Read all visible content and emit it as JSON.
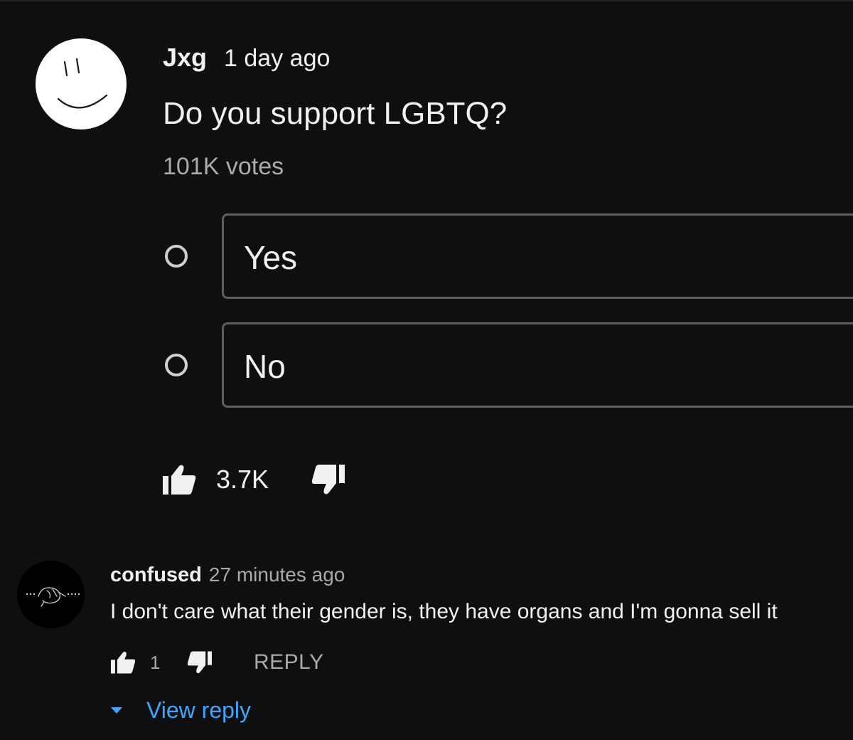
{
  "post": {
    "author": "Jxg",
    "time": "1 day ago",
    "question": "Do you support LGBTQ?",
    "votes": "101K votes",
    "options": [
      {
        "label": "Yes"
      },
      {
        "label": "No"
      }
    ],
    "likes": "3.7K"
  },
  "reply_comment": {
    "author": "confused",
    "time": "27 minutes ago",
    "text": "I don't care what their gender is, they have organs and I'm gonna sell it",
    "likes": "1",
    "reply_label": "REPLY",
    "view_reply_label": "View reply"
  },
  "icons": {
    "like": "thumbs-up-icon",
    "dislike": "thumbs-down-icon",
    "expand": "caret-down-icon"
  },
  "colors": {
    "background": "#0f0f0f",
    "text_primary": "#f1f1f1",
    "text_secondary": "#aaaaaa",
    "link_blue": "#3ea6ff",
    "option_border": "#5e5e5e"
  }
}
